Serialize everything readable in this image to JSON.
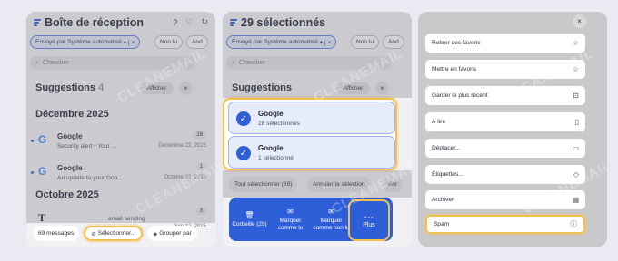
{
  "colors": {
    "accent": "#2e5fd8",
    "highlight": "#f2c14e",
    "bg": "#eaeaf3"
  },
  "watermark": "CLEANEMAIL",
  "panel1": {
    "title": "Boîte de réception",
    "icons": [
      "help-icon",
      "heart-icon",
      "refresh-icon"
    ],
    "filter_chip": "Envoyé par Système automatisé",
    "chip_lu": "Non lu",
    "chip_and": "And",
    "search_placeholder": "Chercher",
    "suggestions_label": "Suggestions",
    "suggestions_count": "4",
    "show_btn": "Afficher",
    "section1": "Décembre 2025",
    "mails": [
      {
        "sender": "Google",
        "subject": "Security alert • Your ...",
        "date": "Décembre 22, 2025",
        "count": "28"
      },
      {
        "sender": "Google",
        "subject": "An update to your Goo...",
        "date": "Octobre 23, 2025",
        "count": "1"
      }
    ],
    "section2": "Octobre 2025",
    "mail3_count": "3",
    "mail3_date": "Juin 12, 2025",
    "mail3_subject": "email sending",
    "messages_btn": "69 messages",
    "select_btn": "Sélectionner...",
    "group_btn": "Grouper par"
  },
  "panel2": {
    "title": "29 sélectionnés",
    "filter_chip": "Envoyé par Système automatisé",
    "chip_lu": "Non lu",
    "chip_and": "And",
    "search_placeholder": "Chercher",
    "suggestions_label": "Suggestions",
    "show_btn": "Afficher",
    "cards": [
      {
        "sender": "Google",
        "detail": "28 sélectionnés"
      },
      {
        "sender": "Google",
        "detail": "1 sélectionné"
      }
    ],
    "select_all": "Tout sélectionner (69)",
    "cancel_sel": "Annuler la sélection",
    "chip_anr": "Anr",
    "actions": [
      {
        "label": "Corbeille (29)",
        "icon": "trash-icon"
      },
      {
        "label": "Marquer comme lu",
        "icon": "envelope-open-icon"
      },
      {
        "label": "Marquer comme non lu",
        "icon": "envelope-icon"
      }
    ],
    "plus_label": "Plus"
  },
  "panel3": {
    "menu": [
      {
        "label": "Retirer des favoris",
        "icon": "unstar-icon"
      },
      {
        "label": "Mettre en favoris",
        "icon": "star-icon"
      },
      {
        "label": "Garder le plus récent",
        "icon": "keep-icon"
      },
      {
        "label": "À lire",
        "icon": "bookmark-icon"
      },
      {
        "label": "Déplacer...",
        "icon": "folder-icon"
      },
      {
        "label": "Étiquettes...",
        "icon": "tag-icon"
      },
      {
        "label": "Archiver",
        "icon": "archive-icon"
      },
      {
        "label": "Spam",
        "icon": "alert-icon"
      }
    ]
  }
}
